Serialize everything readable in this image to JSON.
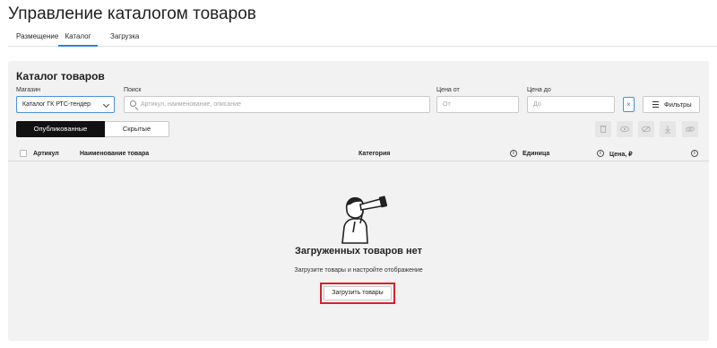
{
  "page": {
    "title": "Управление каталогом товаров"
  },
  "tabs": [
    {
      "label": "Размещение",
      "active": false
    },
    {
      "label": "Каталог",
      "active": true
    },
    {
      "label": "Загрузка",
      "active": false
    }
  ],
  "catalog": {
    "title": "Каталог товаров",
    "filters": {
      "store_label": "Магазин",
      "store_value": "Каталог ГК РТС-тендер",
      "search_label": "Поиск",
      "search_placeholder": "Артикул, наименование, описание",
      "price_from_label": "Цена от",
      "price_from_placeholder": "От",
      "price_to_label": "Цена до",
      "price_to_placeholder": "До",
      "clear_label": "×",
      "filters_button": "Фильтры"
    },
    "segments": {
      "published": "Опубликованные",
      "hidden": "Скрытые"
    },
    "toolbar_icons": [
      "delete-icon",
      "show-icon",
      "hide-icon",
      "download-icon",
      "link-icon"
    ],
    "table": {
      "columns": [
        "Артикул",
        "Наименование товара",
        "Категория",
        "Единица",
        "Цена, ₽"
      ],
      "info_glyph": "i"
    },
    "empty": {
      "title": "Загруженных товаров нет",
      "subtitle": "Загрузите товары и настройте отображение",
      "button": "Загрузить товары"
    }
  },
  "colors": {
    "accent": "#2a83d6",
    "highlight": "#d4232f",
    "panel_bg": "#f2f2f2"
  }
}
